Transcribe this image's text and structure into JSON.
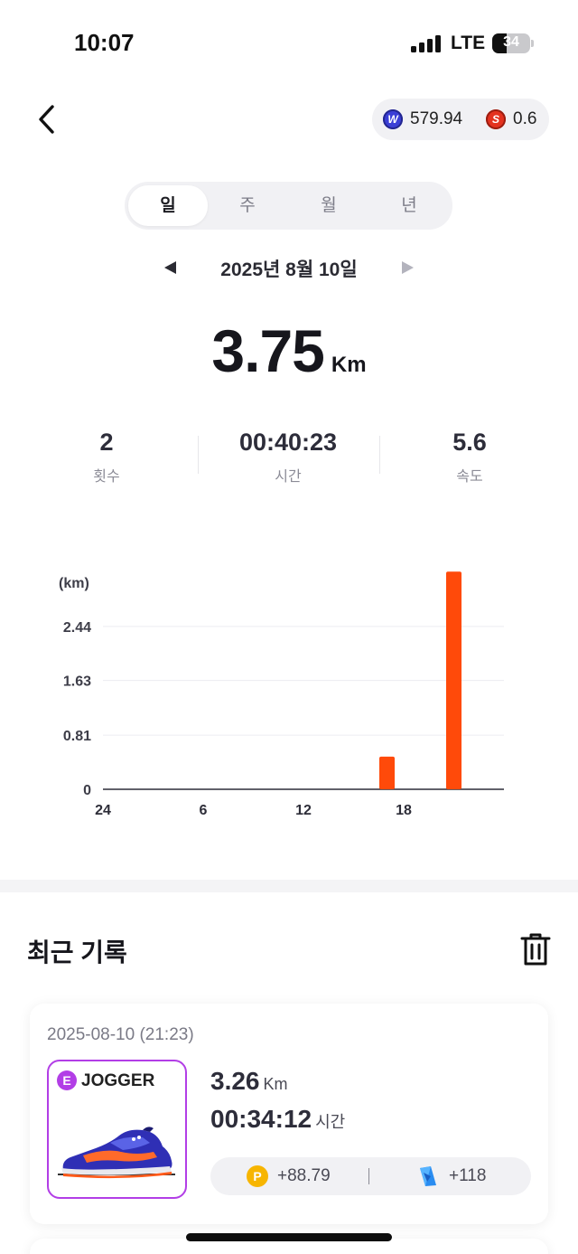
{
  "status_bar": {
    "time": "10:07",
    "network": "LTE",
    "battery": "34"
  },
  "header": {
    "balances": [
      {
        "icon": "w-coin-icon",
        "value": "579.94",
        "color": "#3b3fd6"
      },
      {
        "icon": "s-coin-icon",
        "value": "0.6",
        "color": "#e4321f"
      }
    ]
  },
  "period_tabs": [
    {
      "label": "일",
      "active": true
    },
    {
      "label": "주",
      "active": false
    },
    {
      "label": "월",
      "active": false
    },
    {
      "label": "년",
      "active": false
    }
  ],
  "date": {
    "label": "2025년 8월 10일"
  },
  "summary": {
    "distance": "3.75",
    "unit": "Km",
    "stats": [
      {
        "value": "2",
        "label": "횟수"
      },
      {
        "value": "00:40:23",
        "label": "시간"
      },
      {
        "value": "5.6",
        "label": "속도"
      }
    ]
  },
  "chart_data": {
    "type": "bar",
    "unit_label": "(km)",
    "y_ticks": [
      "0",
      "0.81",
      "1.63",
      "2.44"
    ],
    "ylim": [
      0,
      3.25
    ],
    "x_ticks": [
      "24",
      "6",
      "12",
      "18"
    ],
    "xlim": [
      0,
      23
    ],
    "bars": [
      {
        "hour": 17,
        "value": 0.49
      },
      {
        "hour": 21,
        "value": 3.26
      }
    ],
    "bar_color": "#ff4a0a",
    "grid": true
  },
  "recent": {
    "title": "최근 기록",
    "records": [
      {
        "datetime": "2025-08-10 (21:23)",
        "grade": "E",
        "shoe_type": "JOGGER",
        "distance": "3.26",
        "distance_unit": "Km",
        "duration": "00:34:12",
        "duration_unit": "시간",
        "points_reward": "+88.79",
        "map_reward": "+118",
        "grade_color": "#b23ee6"
      }
    ]
  },
  "colors": {
    "accent": "#ff4a0a",
    "text": "#1c1c22",
    "muted": "#8b8b96"
  }
}
